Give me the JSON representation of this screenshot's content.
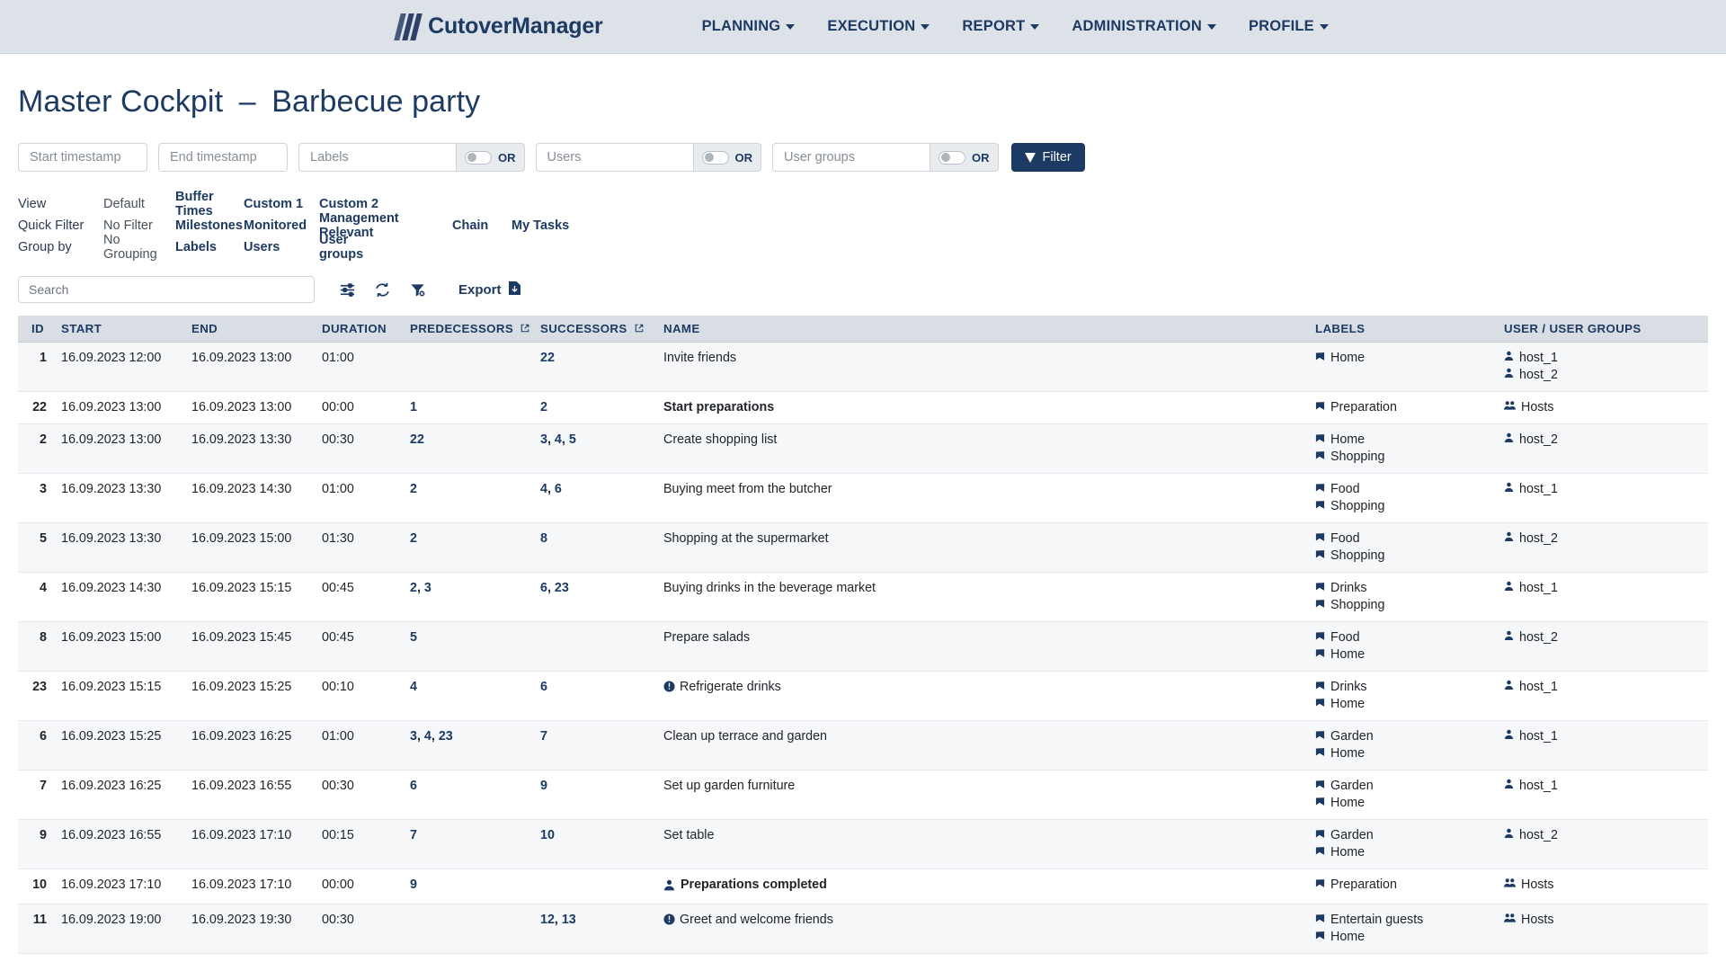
{
  "navbar": {
    "brand": "CutoverManager",
    "items": [
      {
        "label": "PLANNING"
      },
      {
        "label": "EXECUTION"
      },
      {
        "label": "REPORT"
      },
      {
        "label": "ADMINISTRATION"
      },
      {
        "label": "PROFILE"
      }
    ]
  },
  "page": {
    "title_main": "Master Cockpit",
    "title_dash": "–",
    "title_sub": "Barbecue party"
  },
  "filter_bar": {
    "start_timestamp_placeholder": "Start timestamp",
    "start_timestamp_value": "",
    "end_timestamp_placeholder": "End timestamp",
    "end_timestamp_value": "",
    "labels_placeholder": "Labels",
    "labels_value": "",
    "users_placeholder": "Users",
    "users_value": "",
    "user_groups_placeholder": "User groups",
    "user_groups_value": "",
    "or_label": "OR",
    "filter_button": "Filter"
  },
  "options": {
    "view": {
      "key": "View",
      "current": "Default",
      "links": [
        "Buffer Times",
        "Custom 1",
        "Custom 2"
      ]
    },
    "quick_filter": {
      "key": "Quick Filter",
      "current": "No Filter",
      "links": [
        "Milestones",
        "Monitored",
        "Management Relevant",
        "Chain",
        "My Tasks"
      ]
    },
    "group_by": {
      "key": "Group by",
      "current": "No Grouping",
      "links": [
        "Labels",
        "Users",
        "User groups"
      ]
    }
  },
  "toolbar": {
    "search_placeholder": "Search",
    "search_value": "",
    "settings_icon": "sliders-icon",
    "refresh_icon": "refresh-icon",
    "clear_filter_icon": "filter-remove-icon",
    "export_label": "Export",
    "export_icon": "download-file-icon"
  },
  "table": {
    "columns": [
      {
        "label": "ID",
        "align": "right"
      },
      {
        "label": "START"
      },
      {
        "label": "END"
      },
      {
        "label": "DURATION"
      },
      {
        "label": "PREDECESSORS",
        "external": true
      },
      {
        "label": "SUCCESSORS",
        "external": true
      },
      {
        "label": "NAME"
      },
      {
        "label": "LABELS"
      },
      {
        "label": "USER / USER GROUPS"
      }
    ],
    "rows": [
      {
        "id": "1",
        "start": "16.09.2023 12:00",
        "end": "16.09.2023 13:00",
        "duration": "01:00",
        "predecessors": [],
        "successors": [
          "22"
        ],
        "name": "Invite friends",
        "name_bold": false,
        "name_icon": "",
        "labels": [
          "Home"
        ],
        "label_icon": "tag-icon",
        "users": [
          "host_1",
          "host_2"
        ],
        "user_icon": "user-icon"
      },
      {
        "id": "22",
        "start": "16.09.2023 13:00",
        "end": "16.09.2023 13:00",
        "duration": "00:00",
        "predecessors": [
          "1"
        ],
        "successors": [
          "2"
        ],
        "name": "Start preparations",
        "name_bold": true,
        "name_icon": "",
        "labels": [
          "Preparation"
        ],
        "label_icon": "tag-icon",
        "users": [
          "Hosts"
        ],
        "user_icon": "group-icon"
      },
      {
        "id": "2",
        "start": "16.09.2023 13:00",
        "end": "16.09.2023 13:30",
        "duration": "00:30",
        "predecessors": [
          "22"
        ],
        "successors": [
          "3",
          "4",
          "5"
        ],
        "name": "Create shopping list",
        "name_bold": false,
        "name_icon": "",
        "labels": [
          "Home",
          "Shopping"
        ],
        "label_icon": "tag-icon",
        "users": [
          "host_2"
        ],
        "user_icon": "user-icon"
      },
      {
        "id": "3",
        "start": "16.09.2023 13:30",
        "end": "16.09.2023 14:30",
        "duration": "01:00",
        "predecessors": [
          "2"
        ],
        "successors": [
          "4",
          "6"
        ],
        "name": "Buying meet from the butcher",
        "name_bold": false,
        "name_icon": "",
        "labels": [
          "Food",
          "Shopping"
        ],
        "label_icon": "tag-icon",
        "users": [
          "host_1"
        ],
        "user_icon": "user-icon"
      },
      {
        "id": "5",
        "start": "16.09.2023 13:30",
        "end": "16.09.2023 15:00",
        "duration": "01:30",
        "predecessors": [
          "2"
        ],
        "successors": [
          "8"
        ],
        "name": "Shopping at the supermarket",
        "name_bold": false,
        "name_icon": "",
        "labels": [
          "Food",
          "Shopping"
        ],
        "label_icon": "tag-icon",
        "users": [
          "host_2"
        ],
        "user_icon": "user-icon"
      },
      {
        "id": "4",
        "start": "16.09.2023 14:30",
        "end": "16.09.2023 15:15",
        "duration": "00:45",
        "predecessors": [
          "2",
          "3"
        ],
        "successors": [
          "6",
          "23"
        ],
        "name": "Buying drinks in the beverage market",
        "name_bold": false,
        "name_icon": "",
        "labels": [
          "Drinks",
          "Shopping"
        ],
        "label_icon": "tag-icon",
        "users": [
          "host_1"
        ],
        "user_icon": "user-icon"
      },
      {
        "id": "8",
        "start": "16.09.2023 15:00",
        "end": "16.09.2023 15:45",
        "duration": "00:45",
        "predecessors": [
          "5"
        ],
        "successors": [],
        "name": "Prepare salads",
        "name_bold": false,
        "name_icon": "",
        "labels": [
          "Food",
          "Home"
        ],
        "label_icon": "tag-icon",
        "users": [
          "host_2"
        ],
        "user_icon": "user-icon"
      },
      {
        "id": "23",
        "start": "16.09.2023 15:15",
        "end": "16.09.2023 15:25",
        "duration": "00:10",
        "predecessors": [
          "4"
        ],
        "successors": [
          "6"
        ],
        "name": "Refrigerate drinks",
        "name_bold": false,
        "name_icon": "info-icon",
        "labels": [
          "Drinks",
          "Home"
        ],
        "label_icon": "tag-icon",
        "users": [
          "host_1"
        ],
        "user_icon": "user-icon"
      },
      {
        "id": "6",
        "start": "16.09.2023 15:25",
        "end": "16.09.2023 16:25",
        "duration": "01:00",
        "predecessors": [
          "3",
          "4",
          "23"
        ],
        "successors": [
          "7"
        ],
        "name": "Clean up terrace and garden",
        "name_bold": false,
        "name_icon": "",
        "labels": [
          "Garden",
          "Home"
        ],
        "label_icon": "tag-icon",
        "users": [
          "host_1"
        ],
        "user_icon": "user-icon"
      },
      {
        "id": "7",
        "start": "16.09.2023 16:25",
        "end": "16.09.2023 16:55",
        "duration": "00:30",
        "predecessors": [
          "6"
        ],
        "successors": [
          "9"
        ],
        "name": "Set up garden furniture",
        "name_bold": false,
        "name_icon": "",
        "labels": [
          "Garden",
          "Home"
        ],
        "label_icon": "tag-icon",
        "users": [
          "host_1"
        ],
        "user_icon": "user-icon"
      },
      {
        "id": "9",
        "start": "16.09.2023 16:55",
        "end": "16.09.2023 17:10",
        "duration": "00:15",
        "predecessors": [
          "7"
        ],
        "successors": [
          "10"
        ],
        "name": "Set table",
        "name_bold": false,
        "name_icon": "",
        "labels": [
          "Garden",
          "Home"
        ],
        "label_icon": "tag-icon",
        "users": [
          "host_2"
        ],
        "user_icon": "user-icon"
      },
      {
        "id": "10",
        "start": "16.09.2023 17:10",
        "end": "16.09.2023 17:10",
        "duration": "00:00",
        "predecessors": [
          "9"
        ],
        "successors": [],
        "name": "Preparations completed",
        "name_bold": true,
        "name_icon": "milestone-user-icon",
        "labels": [
          "Preparation"
        ],
        "label_icon": "tag-icon",
        "users": [
          "Hosts"
        ],
        "user_icon": "group-icon"
      },
      {
        "id": "11",
        "start": "16.09.2023 19:00",
        "end": "16.09.2023 19:30",
        "duration": "00:30",
        "predecessors": [],
        "successors": [
          "12",
          "13"
        ],
        "name": "Greet and welcome friends",
        "name_bold": false,
        "name_icon": "info-icon",
        "labels": [
          "Entertain guests",
          "Home"
        ],
        "label_icon": "tag-icon",
        "users": [
          "Hosts"
        ],
        "user_icon": "group-icon"
      }
    ]
  },
  "colors": {
    "navbar_bg": "#dde2e9",
    "brand": "#1d3a63",
    "accent": "#1d3a63",
    "table_header_bg": "#d9dee5",
    "row_alt_bg": "#f5f7f9"
  }
}
